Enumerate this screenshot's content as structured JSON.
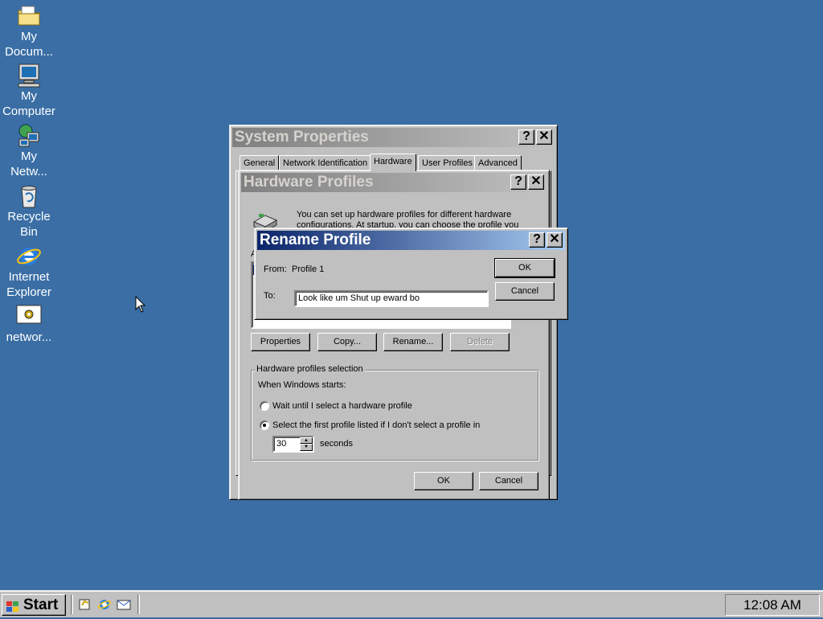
{
  "desktop": {
    "icons": [
      {
        "name": "my-documents",
        "label": "My Docum...",
        "label_line1": "My",
        "label_line2": "Docum..."
      },
      {
        "name": "my-computer",
        "label_line1": "My",
        "label_line2": "Computer"
      },
      {
        "name": "my-network-places",
        "label_line1": "My",
        "label_line2": "Netw..."
      },
      {
        "name": "recycle-bin",
        "label_line1": "Recycle",
        "label_line2": "Bin"
      },
      {
        "name": "internet-explorer",
        "label_line1": "Internet",
        "label_line2": "Explorer"
      },
      {
        "name": "network-shortcut",
        "label_line1": "networ...",
        "label_line2": ""
      }
    ],
    "background_color": "#3a6ea5"
  },
  "system_properties": {
    "title": "System Properties",
    "help_label": "?",
    "close_label": "✕",
    "tabs": [
      "General",
      "Network Identification",
      "Hardware",
      "User Profiles",
      "Advanced"
    ],
    "selected_tab": "Hardware"
  },
  "hardware_profiles": {
    "title": "Hardware Profiles",
    "help_label": "?",
    "close_label": "✕",
    "description_line1": "You can set up hardware profiles for different hardware",
    "description_line2": "configurations. At startup, you can choose the profile you",
    "available_label_fragment": "A",
    "list_fragment": "P",
    "buttons": {
      "properties": "Properties",
      "copy": "Copy...",
      "rename": "Rename...",
      "delete": "Delete"
    },
    "selection_group": {
      "title": "Hardware profiles selection",
      "when_label": "When Windows starts:",
      "option_wait": "Wait until I select a hardware profile",
      "option_first": "Select the first profile listed if I don't select a profile in",
      "selected_option": "option_first",
      "seconds_value": "30",
      "seconds_label": "seconds"
    },
    "ok_label": "OK",
    "cancel_label": "Cancel"
  },
  "rename_profile": {
    "title": "Rename Profile",
    "help_label": "?",
    "close_label": "✕",
    "from_label": "From:",
    "from_value": "Profile 1",
    "to_label": "To:",
    "to_value": "Look like um Shut up eward bo",
    "ok_label": "OK",
    "cancel_label": "Cancel"
  },
  "taskbar": {
    "start_label": "Start",
    "quick_launch": [
      "show-desktop-icon",
      "internet-explorer-icon",
      "outlook-express-icon"
    ],
    "clock": "12:08 AM"
  }
}
